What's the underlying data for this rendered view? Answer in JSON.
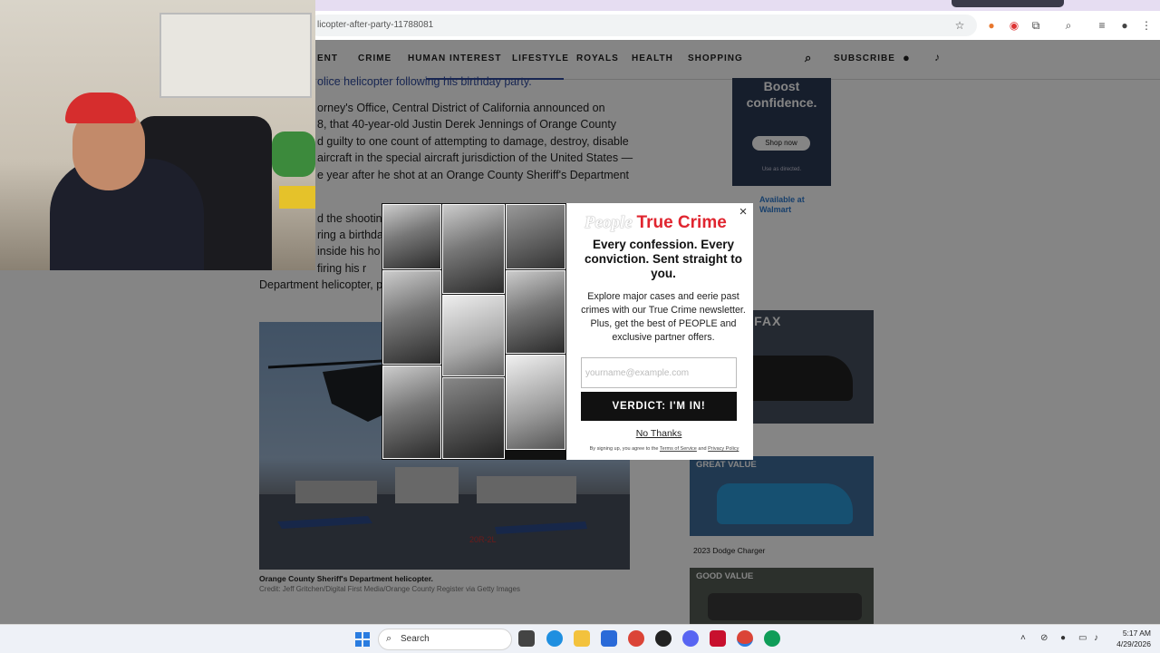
{
  "browser": {
    "url_fragment": "licopter-after-party-11788081",
    "tab_title": ""
  },
  "nav": {
    "items": [
      "ENT",
      "CRIME",
      "HUMAN INTEREST",
      "LIFESTYLE",
      "ROYALS",
      "HEALTH",
      "SHOPPING"
    ],
    "subscribe": "SUBSCRIBE"
  },
  "article": {
    "lines": [
      "olice helicopter following his birthday party.",
      "orney's Office, Central District of California announced on",
      "8, that 40-year-old Justin Derek Jennings of Orange County",
      "d guilty to one count of attempting to damage, destroy, disable",
      "aircraft in the special aircraft jurisdiction of the United States —",
      "e year after he shot at an Orange County Sheriff's Department",
      "d the shootin",
      "ring a birthda",
      "inside his ho",
      "firing his r",
      "Department helicopter, p"
    ],
    "caption": "Orange County Sheriff's Department helicopter.",
    "credit": "Credit: Jeff Gritchen/Digital First Media/Orange County Register via Getty Images",
    "photo_tag": "20R-2L"
  },
  "rail": {
    "ad_headline": "Boost confidence.",
    "ad_button": "Shop now",
    "ad_fine": "Use as directed.",
    "available_at": "Available at",
    "retailer": "Walmart",
    "ad_brand": "RFAX",
    "cards": [
      {
        "badge": "",
        "label": "ger"
      },
      {
        "badge": "GREAT VALUE",
        "label": "2023 Dodge Charger"
      },
      {
        "badge": "GOOD VALUE",
        "label": ""
      }
    ]
  },
  "modal": {
    "logo_people": "People",
    "logo_true_crime": "True Crime",
    "headline": "Every confession. Every conviction. Sent straight to you.",
    "blurb": "Explore major cases and eerie past crimes with our True Crime newsletter. Plus, get the best of PEOPLE and exclusive partner offers.",
    "email_placeholder": "yourname@example.com",
    "email_value": "",
    "cta": "VERDICT: I'M IN!",
    "decline": "No Thanks",
    "legal_prefix": "By signing up, you agree to the",
    "legal_terms": "Terms of Service",
    "legal_and": "and",
    "legal_privacy": "Privacy Policy",
    "close": "×"
  },
  "taskbar": {
    "search_label": "Search",
    "time": "5:17 AM",
    "date": "4/29/2026"
  },
  "colors": {
    "accent_red": "#e0252f",
    "nav_underline": "#2e4a9e",
    "link_blue": "#2e7bd0"
  }
}
